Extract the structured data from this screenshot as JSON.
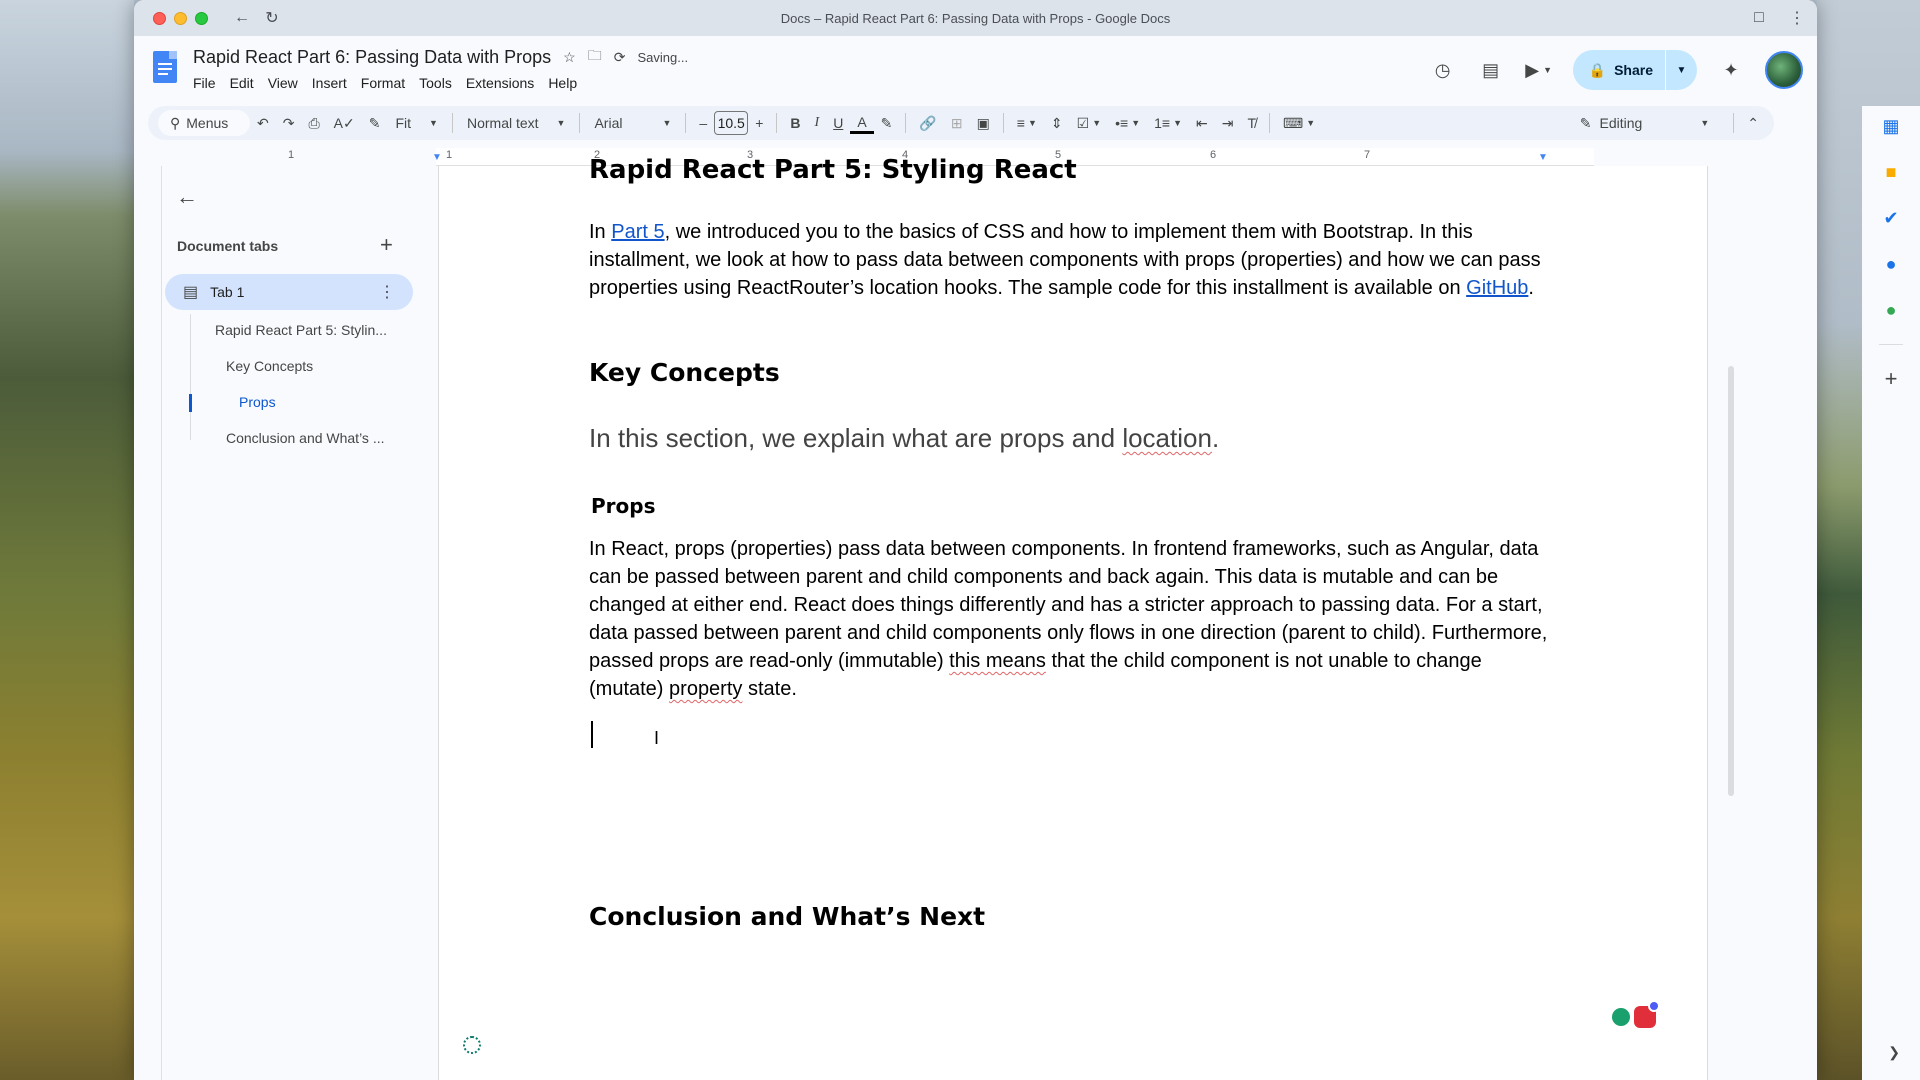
{
  "browser": {
    "window_title": "Docs – Rapid React Part 6: Passing Data with Props - Google Docs"
  },
  "header": {
    "doc_title": "Rapid React Part 6: Passing Data with Props",
    "save_status": "Saving...",
    "menu": [
      "File",
      "Edit",
      "View",
      "Insert",
      "Format",
      "Tools",
      "Extensions",
      "Help"
    ],
    "share_label": "Share"
  },
  "toolbar": {
    "search_label": "Menus",
    "zoom": "Fit",
    "style": "Normal text",
    "font": "Arial",
    "font_size": "10.5",
    "mode": "Editing"
  },
  "ruler": {
    "labels": [
      "1",
      "1",
      "2",
      "3",
      "4",
      "5",
      "6",
      "7"
    ]
  },
  "outline": {
    "heading": "Document tabs",
    "tab_label": "Tab 1",
    "items": [
      "Rapid React Part 5: Stylin...",
      "Key Concepts",
      "Props",
      "Conclusion and What’s ..."
    ]
  },
  "document": {
    "top_heading": "Rapid React Part 5: Styling React",
    "p1_a": "In ",
    "p1_link1": "Part 5",
    "p1_b": ", we introduced you to the basics of CSS and how to implement them with Bootstrap. In this installment, we look at how to pass data between components with props (properties) and how we can pass properties using ReactRouter’s location hooks. The sample code for this installment is available on ",
    "p1_link2": "GitHub",
    "p1_c": ".",
    "key_concepts": "Key Concepts",
    "subtitle_a": "In this section, we explain what are props and ",
    "subtitle_b": "location",
    "subtitle_c": ".",
    "props_heading": "Props",
    "p2_a": "In React, props (properties) pass data between components. In frontend frameworks, such as Angular, data can be passed between parent and child components and back again. This data is mutable and can be changed at either end. React does things differently and has a stricter approach to passing data. For a start, data passed between parent and child components only flows in one direction (parent to child). Furthermore, passed props are read-only (immutable) ",
    "p2_b": "this means",
    "p2_c": " that the child component is not unable to change (mutate) ",
    "p2_d": "property",
    "p2_e": " state.",
    "conclusion": "Conclusion and What’s Next"
  }
}
